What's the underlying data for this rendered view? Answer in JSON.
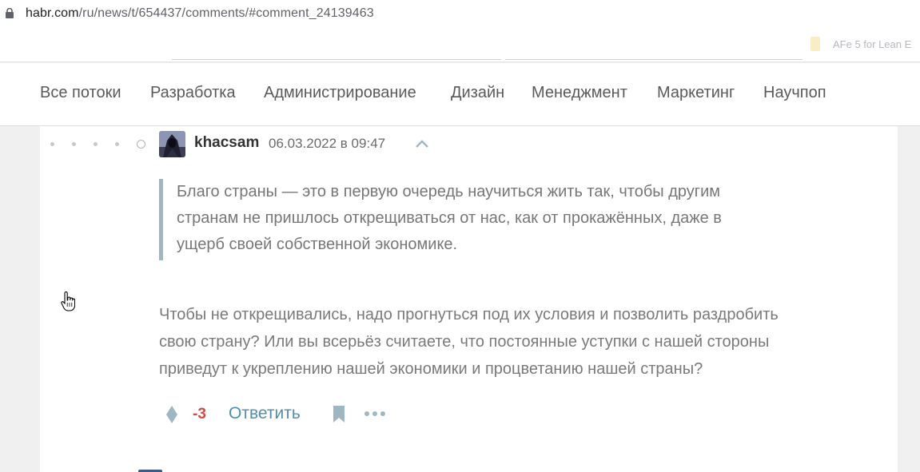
{
  "browser": {
    "url_domain": "habr.com",
    "url_path": "/ru/news/t/654437/comments/#comment_24139463",
    "bookmark_label": "AFe 5 for Lean E"
  },
  "nav": {
    "items": [
      "Все потоки",
      "Разработка",
      "Администрирование",
      "Дизайн",
      "Менеджмент",
      "Маркетинг",
      "Научпоп"
    ]
  },
  "comment": {
    "author": "khacsam",
    "timestamp": "06.03.2022 в 09:47",
    "quote_lines": [
      "Благо страны — это в первую очередь научиться жить так, чтобы другим",
      "странам не пришлось открещиваться от нас, как от прокажённых, даже в",
      "ущерб своей собственной экономике."
    ],
    "body_lines": [
      "Чтобы не открещивались, надо прогнуться под их условия и позволить раздробить",
      "свою страну? Или вы всерьёз считаете, что постоянные уступки с нашей стороны",
      "приведут к укреплению нашей экономики и процветанию нашей страны?"
    ],
    "score": "-3",
    "reply_label": "Ответить"
  },
  "colors": {
    "score_negative": "#d24a43",
    "reply_link": "#548eaa",
    "quote_border": "#9fb6c3"
  },
  "icons": {
    "lock": "lock-icon",
    "collapse": "chevron-up-icon",
    "vote": "vote-diamond-icon",
    "bookmark": "bookmark-icon",
    "more": "more-dots-icon",
    "cursor": "hand-cursor-icon"
  }
}
